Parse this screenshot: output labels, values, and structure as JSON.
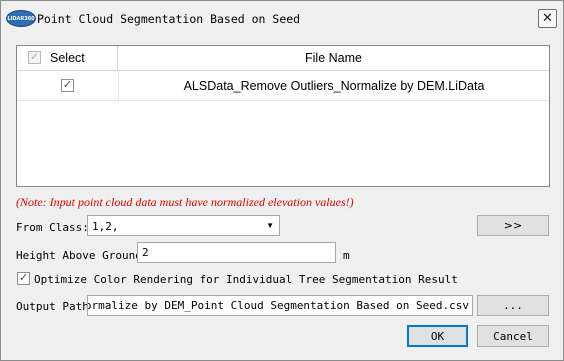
{
  "window": {
    "title": "Point Cloud Segmentation Based on Seed",
    "logo_text": "LIDAR360",
    "close_glyph": "✕"
  },
  "table": {
    "select_header": "Select",
    "file_header": "File Name",
    "header_checked": true,
    "rows": [
      {
        "checked": true,
        "file_name": "ALSData_Remove Outliers_Normalize by DEM.LiData"
      }
    ]
  },
  "note": "(Note: Input point cloud data must have normalized elevation values!)",
  "form": {
    "from_class_label": "From Class:",
    "from_class_value": "1,2,",
    "from_class_button": ">>",
    "height_label": "Height Above Ground",
    "height_value": "2",
    "height_unit": "m",
    "optimize_checked": true,
    "optimize_label": "Optimize Color Rendering for Individual Tree Segmentation Result",
    "output_label": "Output Path:",
    "output_value": "iers_Normalize by DEM_Point Cloud Segmentation Based on Seed.csv",
    "browse_label": "..."
  },
  "buttons": {
    "ok": "OK",
    "cancel": "Cancel"
  },
  "icons": {
    "check": "✓",
    "dropdown": "▼"
  },
  "colors": {
    "note": "#e00000",
    "ok_border": "#0078d7"
  }
}
